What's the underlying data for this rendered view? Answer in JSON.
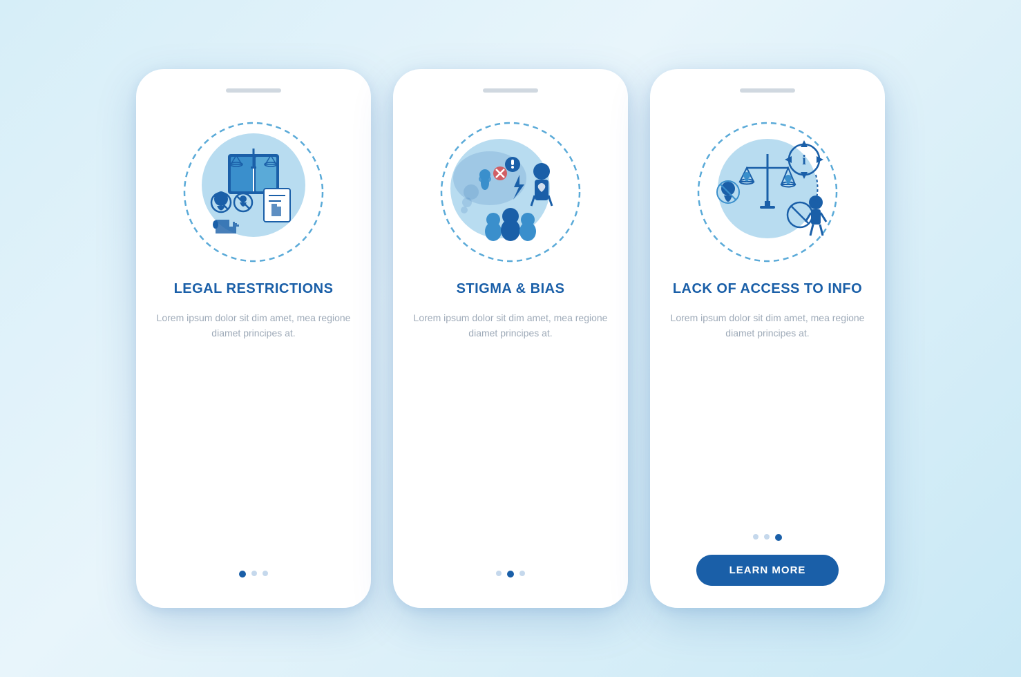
{
  "phones": [
    {
      "id": "phone-legal",
      "title": "LEGAL\nRESTRICTIONS",
      "desc": "Lorem ipsum dolor sit dim amet, mea regione diamet principes at.",
      "dots": [
        true,
        false,
        false
      ],
      "has_button": false
    },
    {
      "id": "phone-stigma",
      "title": "STIGMA & BIAS",
      "desc": "Lorem ipsum dolor sit dim amet, mea regione diamet principes at.",
      "dots": [
        false,
        true,
        false
      ],
      "has_button": false
    },
    {
      "id": "phone-access",
      "title": "LACK OF ACCESS\nTO INFO",
      "desc": "Lorem ipsum dolor sit dim amet, mea regione diamet principes at.",
      "dots": [
        false,
        false,
        true
      ],
      "has_button": true,
      "button_label": "LEARN MORE"
    }
  ],
  "colors": {
    "accent": "#1a5fa8",
    "mid": "#3a8fcc",
    "light": "#5aaad8",
    "pale": "#b8dcf0",
    "text": "#9eaab8"
  }
}
